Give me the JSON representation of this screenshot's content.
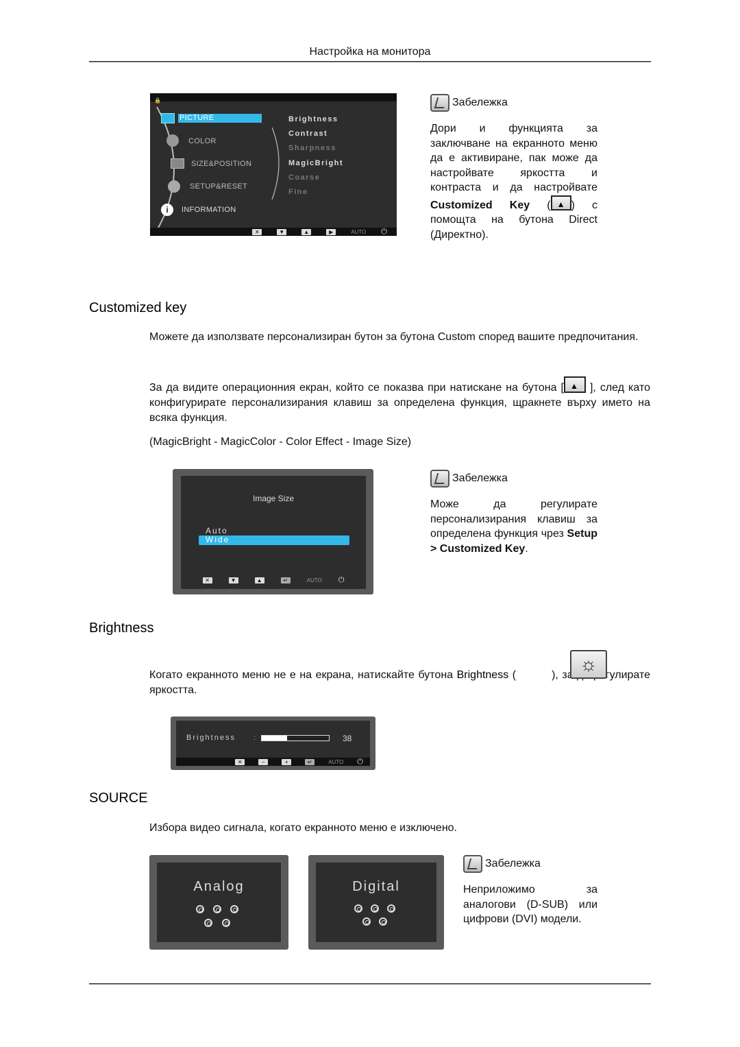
{
  "header": {
    "title": "Настройка на монитора"
  },
  "menu_osd": {
    "categories": [
      "PICTURE",
      "COLOR",
      "SIZE&POSITION",
      "SETUP&RESET",
      "INFORMATION"
    ],
    "active_category": "PICTURE",
    "picture_items": [
      {
        "label": "Brightness",
        "enabled": true
      },
      {
        "label": "Contrast",
        "enabled": true
      },
      {
        "label": "Sharpness",
        "enabled": false
      },
      {
        "label": "MagicBright",
        "enabled": true
      },
      {
        "label": "Coarse",
        "enabled": false
      },
      {
        "label": "Fine",
        "enabled": false
      }
    ],
    "bottom_buttons": [
      "exit-icon",
      "down-icon",
      "up-icon",
      "enter-right-icon",
      "AUTO",
      "power-icon"
    ],
    "auto_label": "AUTO"
  },
  "note1": {
    "title": "Забележка",
    "text_before": "Дори и функцията за заключване на екранното меню да е активиране, пак може да настройвате яркостта и контраста и да настройвате ",
    "bold": "Customized Key",
    "text_paren_open": "(",
    "text_after": ") с помощта на бутона Direct (Директно)."
  },
  "customized_key": {
    "heading": "Customized key",
    "para1": "Можете да използвате персонализиран бутон за бутона Custom според вашите предпочитания.",
    "para2_before": "За да видите операционния екран, който се показва при натискане на бутона [",
    "para2_after": " ], след като конфигурирате персонализирания клавиш за определена функция, щракнете върху името на всяка функция.",
    "list": {
      "open": "(",
      "items": [
        "MagicBright",
        "MagicColor",
        "Color Effect",
        "Image Size"
      ],
      "sep": " - ",
      "close": ")"
    }
  },
  "image_size_osd": {
    "title": "Image Size",
    "options": [
      "Auto",
      "Wide"
    ],
    "selected": "Wide",
    "auto_label": "AUTO"
  },
  "note2": {
    "title": "Забележка",
    "text": "Може да регулирате персонализирания клавиш за определена функция чрез ",
    "bold": "Setup > Customized Key",
    "end": "."
  },
  "brightness": {
    "heading": "Brightness",
    "text_before": "Когато екранното меню не е на екрана, натискайте бутона ",
    "bold": "Brightness",
    "text_after": ", за да регулирате яркостта.",
    "osd": {
      "label": "Brightness",
      "separator": ":",
      "value": 38,
      "value_text": "38",
      "auto_label": "AUTO"
    }
  },
  "source": {
    "heading": "SOURCE",
    "text": "Избора видео сигнала, когато екранното меню е изключено.",
    "screens": [
      "Analog",
      "Digital"
    ]
  },
  "note3": {
    "title": "Забележка",
    "text": "Неприложимо за аналогови (D-SUB) или цифрови (DVI) модели."
  }
}
